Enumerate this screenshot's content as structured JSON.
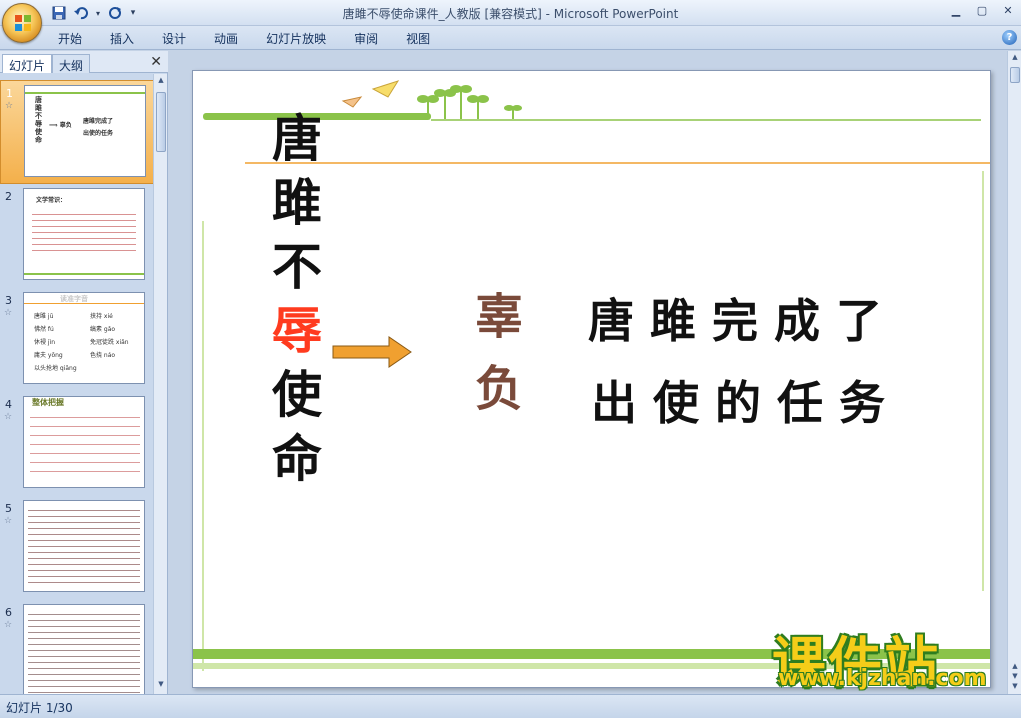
{
  "window": {
    "title": "唐雎不辱使命课件_人教版 [兼容模式] - Microsoft PowerPoint",
    "minimize_icon": "minimize-icon",
    "restore_icon": "restore-icon",
    "close_icon": "close-icon"
  },
  "quick_access": {
    "save_icon": "save-icon",
    "undo_icon": "undo-icon",
    "redo_icon": "redo-icon"
  },
  "ribbon": {
    "tabs": [
      "开始",
      "插入",
      "设计",
      "动画",
      "幻灯片放映",
      "审阅",
      "视图"
    ],
    "help_label": "?"
  },
  "side_pane": {
    "tab_slides": "幻灯片",
    "tab_outline": "大纲",
    "close_label": "✕",
    "thumbnails": [
      {
        "num": "1",
        "lines": [
          "唐雎不辱使命",
          "⟹  辜负",
          "唐雎完成了",
          "出使的任务"
        ]
      },
      {
        "num": "2",
        "lines": [
          "文学常识："
        ]
      },
      {
        "num": "3",
        "lines": [
          "读准字音",
          "唐雎 jū",
          "挟持 xié",
          "怫然 fú",
          "休祲 jìn",
          "缟素 gǎo",
          "免冠徒跣 xiǎn",
          "庸夫 yōng",
          "色挠 náo",
          "以头抢地 qiāng"
        ]
      },
      {
        "num": "4",
        "lines": [
          "整体把握"
        ]
      },
      {
        "num": "5",
        "lines": []
      },
      {
        "num": "6",
        "lines": []
      }
    ]
  },
  "slide": {
    "title_chars_before": [
      "唐",
      "雎",
      "不"
    ],
    "title_char_highlight": "辱",
    "title_chars_after": [
      "使",
      "命"
    ],
    "zhang": [
      "辜",
      "负"
    ],
    "line1": "唐雎完成了",
    "line2": "出使的任务"
  },
  "watermark": {
    "brand": "课件站",
    "url": "www.kjzhan.com"
  },
  "status": {
    "slide_counter": "幻灯片 1/30"
  },
  "colors": {
    "accent_green": "#8bc34a",
    "accent_orange": "#f0a030",
    "highlight_red": "#ff3b1f"
  }
}
